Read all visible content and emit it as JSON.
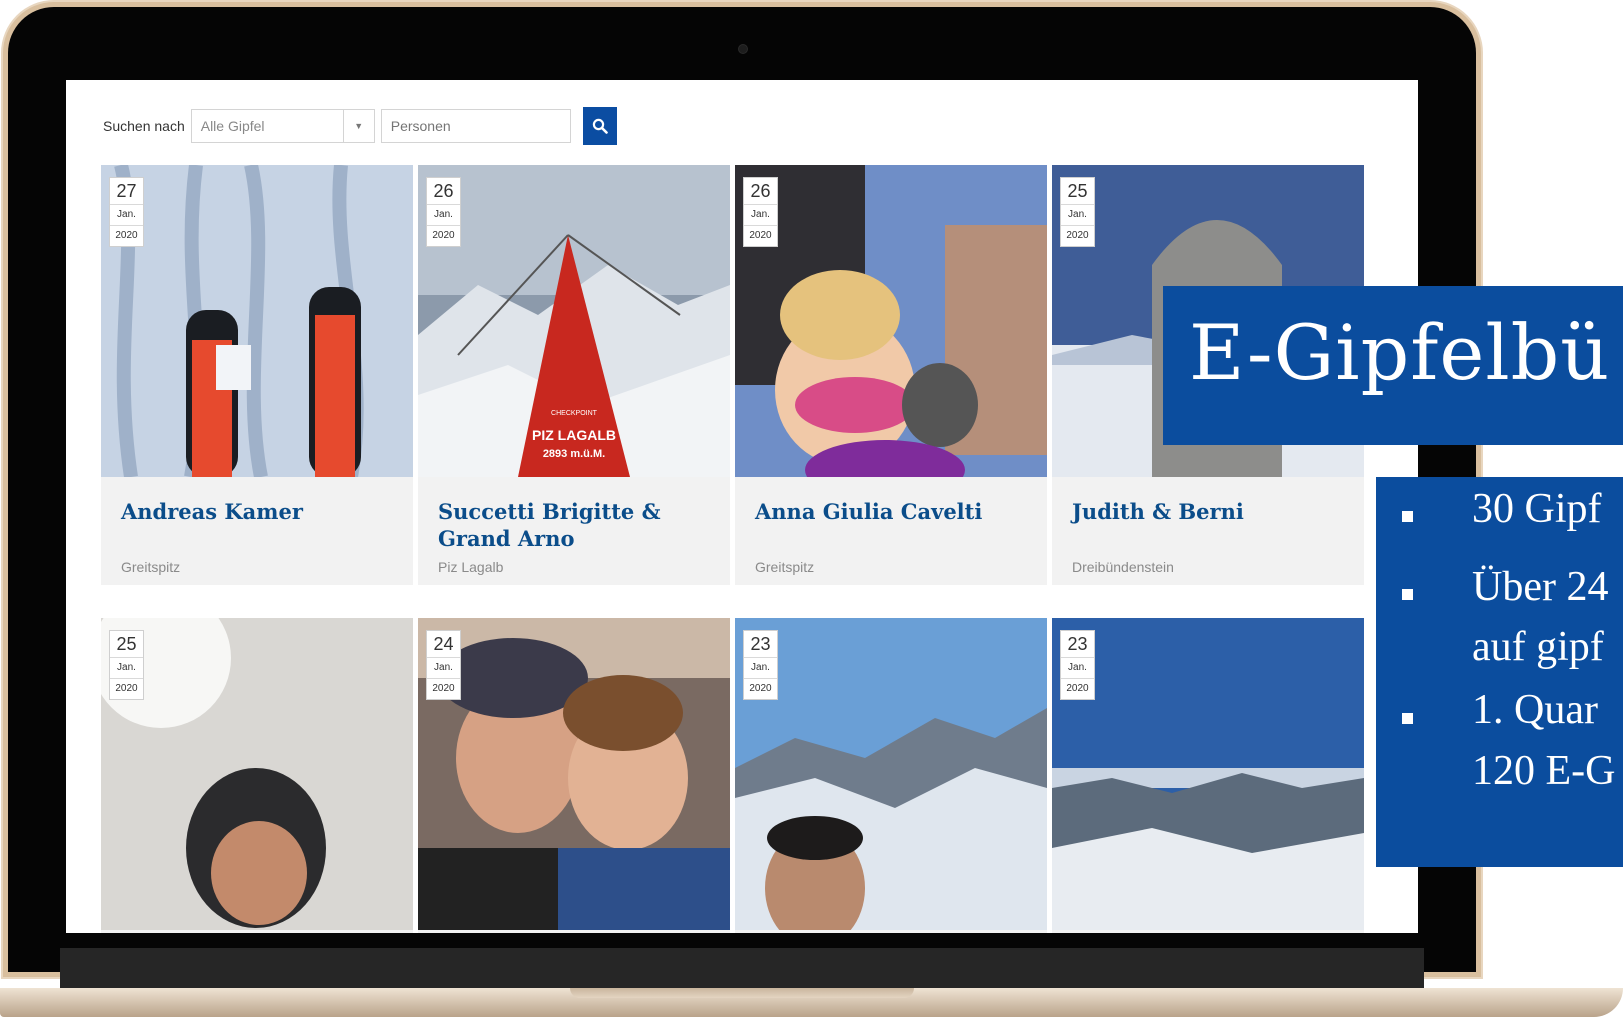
{
  "search": {
    "label": "Suchen nach",
    "summit_select": "Alle Gipfel",
    "person_placeholder": "Personen"
  },
  "cards": [
    {
      "day": "27",
      "month": "Jan.",
      "year": "2020",
      "name": "Andreas Kamer",
      "summit": "Greitspitz"
    },
    {
      "day": "26",
      "month": "Jan.",
      "year": "2020",
      "name": "Succetti Brigitte & Grand Arno",
      "summit": "Piz Lagalb",
      "photo_text": "PIZ LAGALB",
      "photo_sub": "2893 m.ü.M.",
      "photo_small": "CHECKPOINT"
    },
    {
      "day": "26",
      "month": "Jan.",
      "year": "2020",
      "name": "Anna Giulia Cavelti",
      "summit": "Greitspitz"
    },
    {
      "day": "25",
      "month": "Jan.",
      "year": "2020",
      "name": "Judith & Berni",
      "summit": "Dreibündenstein"
    },
    {
      "day": "25",
      "month": "Jan.",
      "year": "2020"
    },
    {
      "day": "24",
      "month": "Jan.",
      "year": "2020"
    },
    {
      "day": "23",
      "month": "Jan.",
      "year": "2020"
    },
    {
      "day": "23",
      "month": "Jan.",
      "year": "2020"
    }
  ],
  "overlay": {
    "title": "E-Gipfelbü",
    "lines": [
      "30 Gipf",
      "Über 24",
      "auf gipf",
      "1. Quar",
      "120 E-G"
    ]
  }
}
